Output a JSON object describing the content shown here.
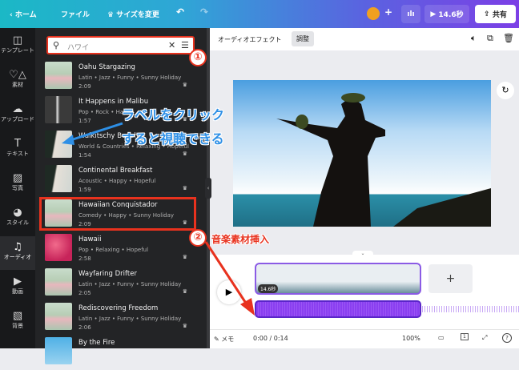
{
  "topbar": {
    "back_label": "ホーム",
    "file_label": "ファイル",
    "resize_label": "サイズを変更",
    "play_duration": "14.6秒",
    "share_label": "共有"
  },
  "nav": [
    {
      "icon": "template-icon",
      "glyph": "◫",
      "label": "テンプレート"
    },
    {
      "icon": "elements-icon",
      "glyph": "♡△",
      "label": "素材"
    },
    {
      "icon": "upload-icon",
      "glyph": "☁",
      "label": "アップロード"
    },
    {
      "icon": "text-icon",
      "glyph": "T",
      "label": "テキスト"
    },
    {
      "icon": "photo-icon",
      "glyph": "▨",
      "label": "写真"
    },
    {
      "icon": "style-icon",
      "glyph": "◕",
      "label": "スタイル"
    },
    {
      "icon": "audio-icon",
      "glyph": "♫",
      "label": "オーディオ"
    },
    {
      "icon": "video-icon",
      "glyph": "▶",
      "label": "動画"
    },
    {
      "icon": "background-icon",
      "glyph": "▧",
      "label": "背景"
    }
  ],
  "search": {
    "value": "ハワイ"
  },
  "tracks": [
    {
      "title": "Oahu Stargazing",
      "tags": "Latin • Jazz • Funny • Sunny Holiday",
      "duration": "2:09"
    },
    {
      "title": "It Happens in Malibu",
      "tags": "Pop • Rock • Happy",
      "duration": "1:57"
    },
    {
      "title": "Waikitschy Beach",
      "tags": "World & Countries • Relaxing • Hopeful",
      "duration": "1:54"
    },
    {
      "title": "Continental Breakfast",
      "tags": "Acoustic • Happy • Hopeful",
      "duration": "1:59"
    },
    {
      "title": "Hawaiian Conquistador",
      "tags": "Comedy • Happy • Sunny Holiday",
      "duration": "2:09"
    },
    {
      "title": "Hawaii",
      "tags": "Pop • Relaxing • Hopeful",
      "duration": "2:58"
    },
    {
      "title": "Wayfaring Drifter",
      "tags": "Latin • Jazz • Funny • Sunny Holiday",
      "duration": "2:05"
    },
    {
      "title": "Rediscovering Freedom",
      "tags": "Latin • Jazz • Funny • Sunny Holiday",
      "duration": "2:06"
    },
    {
      "title": "By the Fire",
      "tags": "",
      "duration": ""
    }
  ],
  "annotations": {
    "num1": "①",
    "num2": "②",
    "label_hint_1": "ラベルをクリック",
    "label_hint_2": "すると視聴できる",
    "insert_hint": "音楽素材挿入"
  },
  "toolbar": {
    "audio_effect": "オーディオエフェクト",
    "adjust": "調整"
  },
  "timeline": {
    "clip_duration": "14.6秒",
    "add": "+"
  },
  "bottombar": {
    "notes": "メモ",
    "time": "0:00 / 0:14",
    "zoom": "100%",
    "page": "1",
    "help": "?"
  }
}
